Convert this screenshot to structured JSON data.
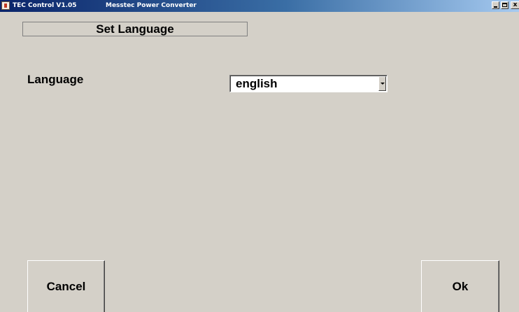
{
  "window": {
    "app_title": "TEC Control V1.05",
    "subtitle": "Messtec Power Converter",
    "icon": "app-icon",
    "controls": {
      "minimize_icon": "minimize-icon",
      "maximize_icon": "maximize-icon",
      "close_label": "x"
    }
  },
  "dialog": {
    "heading": "Set Language",
    "language_label": "Language",
    "language_select": {
      "selected": "english",
      "dropdown_icon": "chevron-down-icon"
    }
  },
  "buttons": {
    "cancel": "Cancel",
    "ok": "Ok"
  },
  "colors": {
    "background": "#d4d0c8",
    "titlebar_start": "#0a246a",
    "titlebar_end": "#a6caf0",
    "text": "#000000"
  }
}
